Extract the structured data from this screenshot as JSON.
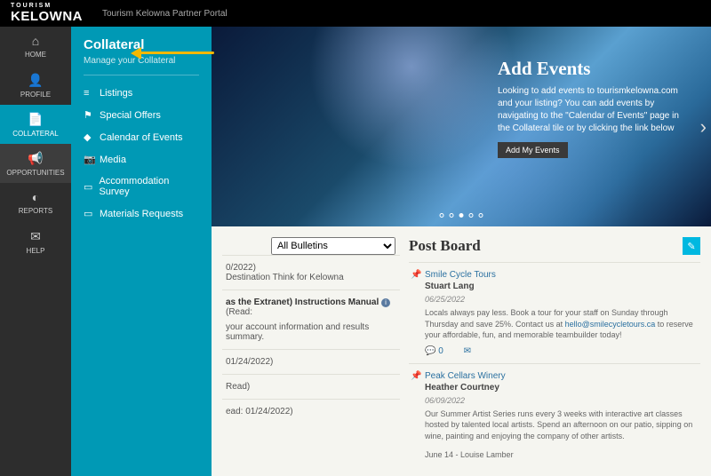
{
  "header": {
    "logo_line1": "TOURISM",
    "logo_line2": "KELOWNA",
    "portal_label": "Tourism Kelowna Partner Portal"
  },
  "sidebar": {
    "items": [
      {
        "label": "HOME",
        "icon": "⌂"
      },
      {
        "label": "PROFILE",
        "icon": "👤"
      },
      {
        "label": "COLLATERAL",
        "icon": "📄"
      },
      {
        "label": "OPPORTUNITIES",
        "icon": "📢"
      },
      {
        "label": "REPORTS",
        "icon": "◐"
      },
      {
        "label": "HELP",
        "icon": "✉"
      }
    ]
  },
  "submenu": {
    "title": "Collateral",
    "subtitle": "Manage your Collateral",
    "items": [
      {
        "label": "Listings",
        "icon": "≡"
      },
      {
        "label": "Special Offers",
        "icon": "⚑"
      },
      {
        "label": "Calendar of Events",
        "icon": "◆"
      },
      {
        "label": "Media",
        "icon": "📷"
      },
      {
        "label": "Accommodation Survey",
        "icon": "▭"
      },
      {
        "label": "Materials Requests",
        "icon": "▭"
      }
    ]
  },
  "hero": {
    "title": "Add Events",
    "body": "Looking to add events to tourismkelowna.com and your listing? You can add events by navigating to the \"Calendar of Events\" page in the Collateral tile or by clicking the link below",
    "button": "Add My Events"
  },
  "bulletins": {
    "filter_selected": "All Bulletins",
    "items": [
      {
        "date_frag": "0/2022)",
        "text_frag": "Destination Think for Kelowna"
      },
      {
        "title_frag": "as the Extranet) Instructions Manual",
        "read": "(Read:",
        "text_frag": "your account information and results summary."
      },
      {
        "date_frag": "01/24/2022)"
      },
      {
        "read_frag": "Read)"
      },
      {
        "read_date_frag": "ead: 01/24/2022)"
      }
    ]
  },
  "postboard": {
    "title": "Post Board",
    "posts": [
      {
        "title": "Smile Cycle Tours",
        "author": "Stuart Lang",
        "date": "06/25/2022",
        "body_pre": "Locals always pay less. Book a tour for your staff on Sunday through Thursday and save 25%. Contact us at ",
        "link": "hello@smilecycletours.ca",
        "body_post": " to reserve your affordable, fun, and memorable teambuilder today!",
        "comments": "0"
      },
      {
        "title": "Peak Cellars Winery",
        "author": "Heather Courtney",
        "date": "06/09/2022",
        "body": "Our Summer Artist Series runs every 3 weeks with interactive art classes hosted by talented local artists. Spend an afternoon on our patio, sipping on wine, painting and enjoying the company of other artists.",
        "extra": "June 14 - Louise Lamber"
      }
    ]
  }
}
